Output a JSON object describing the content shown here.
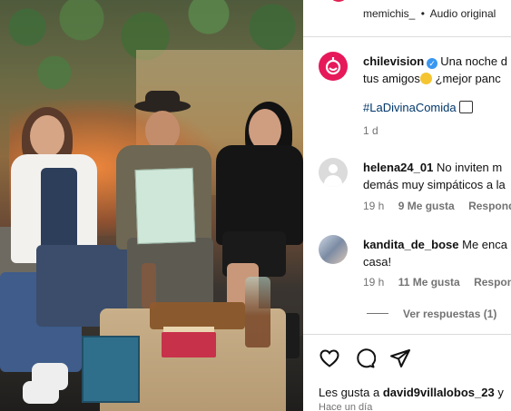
{
  "post_header": {
    "username": "memichis_",
    "separator": "•",
    "audio_label": "Audio original"
  },
  "caption": {
    "username": "chilevision",
    "text_part1": "Una noche d",
    "text_part2": "tus amigos",
    "text_part3": "¿mejor panc",
    "hashtag": "#LaDivinaComida",
    "time": "1 d"
  },
  "comments": [
    {
      "username": "helena24_01",
      "text_line1": "No inviten m",
      "text_line2": "demás muy simpáticos a la",
      "time": "19 h",
      "likes": "9 Me gusta",
      "reply": "Responde"
    },
    {
      "username": "kandita_de_bose",
      "text_line1": "Me enca",
      "text_line2": "casa!",
      "time": "19 h",
      "likes": "11 Me gusta",
      "reply": "Responde",
      "view_replies": "Ver respuestas (1)"
    }
  ],
  "likes_line": {
    "prefix": "Les gusta a",
    "user": "david9villalobos_23",
    "suffix": "y"
  },
  "footer_time": "Hace un día",
  "colors": {
    "brand": "#e6195a",
    "verified": "#3897f0",
    "hashtag": "#00376b",
    "muted": "#737373"
  },
  "icons": [
    "heart-icon",
    "comment-icon",
    "share-icon",
    "verified-icon",
    "clapper-icon",
    "smiley-hearts-icon"
  ]
}
